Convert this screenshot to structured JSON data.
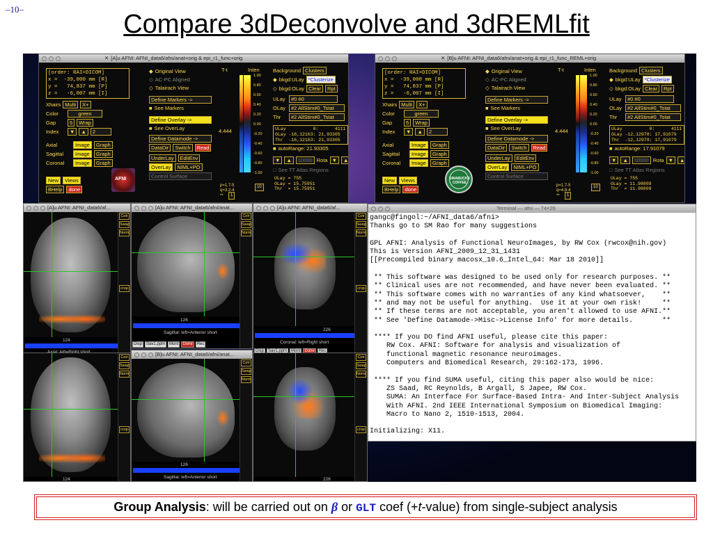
{
  "slide": {
    "number": "–10–",
    "title": "Compare 3dDeconvolve and 3dREMLfit",
    "footer": {
      "bold": "Group Analysis",
      "text1": ": will be carried out on ",
      "beta": "β",
      "text2": " or ",
      "glt": "GLT",
      "text3": " coef (+",
      "t": "t",
      "text4": "-value) from single-subject analysis"
    }
  },
  "afni_left": {
    "title": "[A]u AFNI: AFNI_data6/afni/anat+orig & epi_r1_func+orig",
    "coord": "[order: RAI=DICOM]\nx =  -39,000 mm [R]\ny =   74,837 mm [P]\nz =   -6,007 mm [I]",
    "ulay_info": "ULay          0:      4111\nOLay -16,12163: 21,93305\nThr  -16,12163: 21,93305",
    "autorange": "autoRange: 21.93305",
    "level": "4.444",
    "pval": "p=1.7-5\nq=3.2-4",
    "stats": "ULay = 755\nOLay = 15.75951\nThr  = 15.75951",
    "olay": "#2 AllStim#0_Tstat",
    "thr": "#2 AllStim#0_Tstat",
    "logo": "AFNI"
  },
  "afni_right": {
    "title": "[B]u AFNI: AFNI_data6/afni/anat+orig & epi_r1_func_REML+orig",
    "coord": "[order: RAI=DICOM]\nx =  -39,000 mm [R]\ny =   74,837 mm [P]\nz =   -6,007 mm [I]",
    "ulay_info": "ULay          0:      4111\nOLay -12,12978: 17,91079\nThr  -12,12978: 17,91079",
    "autorange": "autoRange: 17.91079",
    "level": "4.444",
    "pval": "p=1.7-5\nq=4.8-4",
    "stats": "ULay = 755\nOLay = 11.98809\nThr  = 11.98809",
    "olay": "#2 AllStim#0_Tstat",
    "thr": "#2 AllStim#0_Tstat",
    "logo": "SINABUCKS COFFEE"
  },
  "panel_common": {
    "original_view": "Original View",
    "acpc": "AC-PC Aligned",
    "talairach": "Talairach View",
    "xhairs_label": "Xhairs",
    "xhairs_val": "Multi",
    "color_label": "Color",
    "color_val": "green",
    "gap_label": "Gap",
    "gap_val": "5",
    "wrap": "Wrap",
    "index_label": "Index",
    "index_val": "2",
    "axial": "Axial",
    "sagittal": "Sagittal",
    "coronal": "Coronal",
    "image": "Image",
    "graph": "Graph",
    "define_markers": "Define Markers ->",
    "see_markers": "See Markers",
    "define_overlay": "Define Overlay ->",
    "see_overlay": "See OverLay",
    "define_datamode": "Define Datamode ->",
    "datadir": "DataDir",
    "switch": "Switch",
    "read": "Read",
    "underlay": "UnderLay",
    "editenv": "EditEnv",
    "overlay": "OverLay",
    "niml": "NIML+PO",
    "control_surface": "Control Surface",
    "new": "New",
    "views": "Views",
    "bhelp": "BHelp",
    "done": "done",
    "tt": "T-t",
    "inten": "Inten",
    "background": "Background",
    "clusters": "Clusters",
    "bkgd_ulay": "bkgd:ULay",
    "bkgd_olay": "bkgd:OLay",
    "clusterize": "*Clusterize",
    "clear": "Clear",
    "rpt": "Rpt",
    "ulay_label": "ULay",
    "ulay_val": "#0 #0",
    "olay_label": "OLay",
    "thr_label": "Thr",
    "range": "10000",
    "rota": "Rota",
    "see_tt": "See TT Atlas Regions",
    "ten": "10",
    "one": "1",
    "pos": "Pos?",
    "scale_ticks": [
      "1.00",
      "0.80",
      "0.60",
      "0.40",
      "0.20",
      "0.00",
      "-0.20",
      "-0.40",
      "-0.60",
      "-0.80",
      "-1.00"
    ]
  },
  "viewers": {
    "axial_title": "[A]u AFNI: AFNI_data6/af...",
    "sagittal_title": "[A]u AFNI: AFNI_data6/afni/anat...",
    "coronal_title": "[A]u AFNI: AFNI_data6/af...",
    "sagittal_b_title": "[B]u AFNI: AFNI_data6/afni/anat...",
    "axial_caption": "Axial: left=Right short",
    "sagittal_caption": "Sagittal: left=Anterior short",
    "coronal_caption": "Coronal: left=Right short",
    "axial_slice": "124",
    "sagittal_slice": "126",
    "coronal_slice": "226",
    "side_labels": [
      "Colr",
      "Swap",
      "Norm"
    ],
    "crop": "crop",
    "bottom_buttons": [
      "Disp",
      "Sav1.ppm",
      "Mont",
      "Done",
      "Rec"
    ]
  },
  "terminal": {
    "title": "Terminal — afni — 74×26",
    "lines": "gangc@fingol:~/AFNI_data6/afni>\nThanks go to SM Rao for many suggestions\n\nGPL AFNI: Analysis of Functional NeuroImages, by RW Cox (rwcox@nih.gov)\nThis is Version AFNI_2009_12_31_1431\n[[Precompiled binary macosx_10.6_Intel_64: Mar 18 2010]]\n\n ** This software was designed to be used only for research purposes. **\n ** Clinical uses are not recommended, and have never been evaluated. **\n ** This software comes with no warranties of any kind whatsoever,    **\n ** and may not be useful for anything.  Use it at your own risk!     **\n ** If these terms are not acceptable, you aren't allowed to use AFNI.**\n ** See 'Define Datamode->Misc->License Info' for more details.       **\n\n **** If you DO find AFNI useful, please cite this paper:\n    RW Cox. AFNI: Software for analysis and visualization of\n    functional magnetic resonance neuroimages.\n    Computers and Biomedical Research, 29:162-173, 1996.\n\n **** If you find SUMA useful, citing this paper also would be nice:\n    ZS Saad, RC Reynolds, B Argall, S Japee, RW Cox.\n    SUMA: An Interface For Surface-Based Intra- And Inter-Subject Analysis\n    With AFNI. 2nd IEEE International Symposium on Biomedical Imaging:\n    Macro to Nano 2, 1510-1513, 2004.\n\nInitializing: X11."
  },
  "colors": {
    "accent": "#ffd84a",
    "title_link": "#1a1aa0",
    "footer_border": "#d21c1c",
    "glt": "#1a1ac8"
  }
}
